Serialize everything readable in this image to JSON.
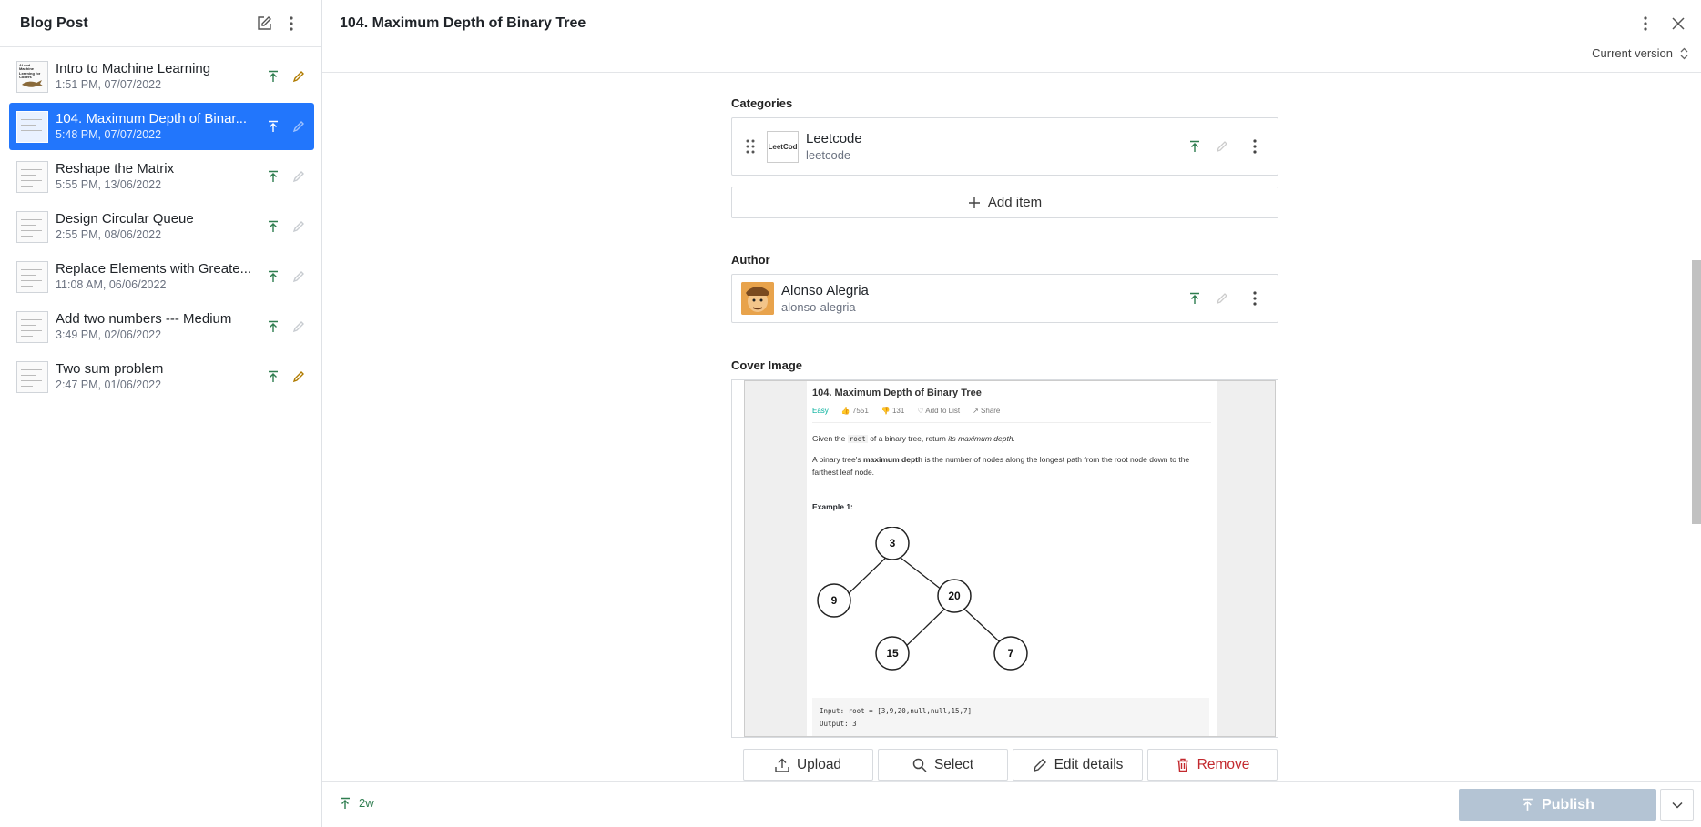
{
  "sidebar": {
    "title": "Blog Post",
    "items": [
      {
        "title": "Intro to Machine Learning",
        "date": "1:51 PM, 07/07/2022",
        "edit_active": true
      },
      {
        "title": "104. Maximum Depth of Binar...",
        "date": "5:48 PM, 07/07/2022",
        "edit_active": false
      },
      {
        "title": "Reshape the Matrix",
        "date": "5:55 PM, 13/06/2022",
        "edit_active": false
      },
      {
        "title": "Design Circular Queue",
        "date": "2:55 PM, 08/06/2022",
        "edit_active": false
      },
      {
        "title": "Replace Elements with Greate...",
        "date": "11:08 AM, 06/06/2022",
        "edit_active": false
      },
      {
        "title": "Add two numbers --- Medium",
        "date": "3:49 PM, 02/06/2022",
        "edit_active": false
      },
      {
        "title": "Two sum problem",
        "date": "2:47 PM, 01/06/2022",
        "edit_active": true
      }
    ],
    "thumb_text": "AI and Machine Learning for Coders"
  },
  "main": {
    "title": "104. Maximum Depth of Binary Tree",
    "version_label": "Current version"
  },
  "categories": {
    "label": "Categories",
    "item": {
      "title": "Leetcode",
      "slug": "leetcode",
      "thumb_text": "LeetCod"
    },
    "add_label": "Add item"
  },
  "author": {
    "label": "Author",
    "name": "Alonso Alegria",
    "slug": "alonso-alegria"
  },
  "cover": {
    "label": "Cover Image",
    "image": {
      "title": "104. Maximum Depth of Binary Tree",
      "difficulty": "Easy",
      "likes": "7551",
      "dislikes": "131",
      "add_to_list": "Add to List",
      "share": "Share",
      "p1_a": "Given the",
      "p1_code": "root",
      "p1_b": "of a binary tree, return",
      "p1_em": "its maximum depth.",
      "p2_a": "A binary tree's",
      "p2_b": "maximum depth",
      "p2_c": "is the number of nodes along the longest path from the root node down to the farthest leaf node.",
      "example": "Example 1:",
      "nodes": [
        "3",
        "9",
        "20",
        "15",
        "7"
      ],
      "input_line": "Input: root = [3,9,20,null,null,15,7]",
      "output_line": "Output: 3"
    },
    "buttons": {
      "upload": "Upload",
      "select": "Select",
      "edit": "Edit details",
      "remove": "Remove"
    }
  },
  "footer": {
    "sync_label": "2w",
    "publish_label": "Publish"
  },
  "colors": {
    "accent": "#2276fc",
    "published": "#2e7d4f",
    "danger": "#c3292e",
    "publish_disabled": "#b4c4d4"
  }
}
